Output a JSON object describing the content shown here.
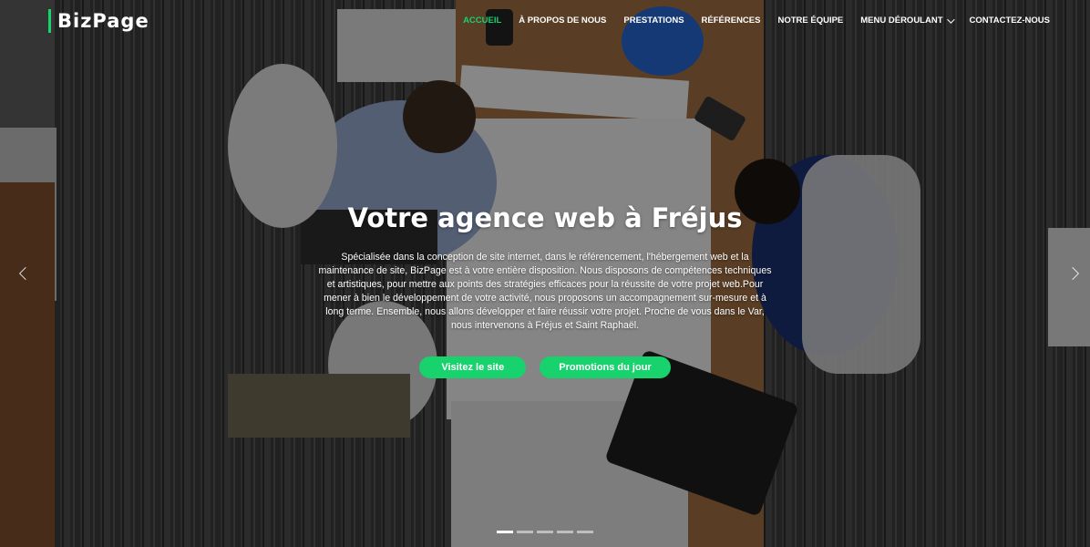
{
  "brand": {
    "name": "BizPage",
    "accent": "#18d26e"
  },
  "nav": {
    "items": [
      {
        "label": "Accueil",
        "active": true
      },
      {
        "label": "À propos de nous"
      },
      {
        "label": "Prestations"
      },
      {
        "label": "Références"
      },
      {
        "label": "Notre équipe"
      },
      {
        "label": "Menu déroulant",
        "dropdown": true
      },
      {
        "label": "Contactez-nous"
      }
    ]
  },
  "hero": {
    "title": "Votre agence web à Fréjus",
    "text": "Spécialisée dans la conception de site internet, dans le référencement, l'hébergement web et la maintenance de site, BizPage est à votre entière disposition. Nous disposons de compétences techniques et artistiques, pour mettre aux points des stratégies efficaces pour la réussite de votre projet web.Pour mener à bien le développement de votre activité, nous proposons un accompagnement sur-mesure et à long terme. Ensemble, nous allons développer et faire réussir votre projet. Proche de vous dans le Var, nous intervenons à Fréjus et Saint Raphaël.",
    "buttons": {
      "primary": "Visitez le site",
      "secondary": "Promotions du jour"
    }
  },
  "carousel": {
    "prev_icon": "chevron-left-icon",
    "next_icon": "chevron-right-icon",
    "slide_count": 5,
    "active_slide": 1
  }
}
